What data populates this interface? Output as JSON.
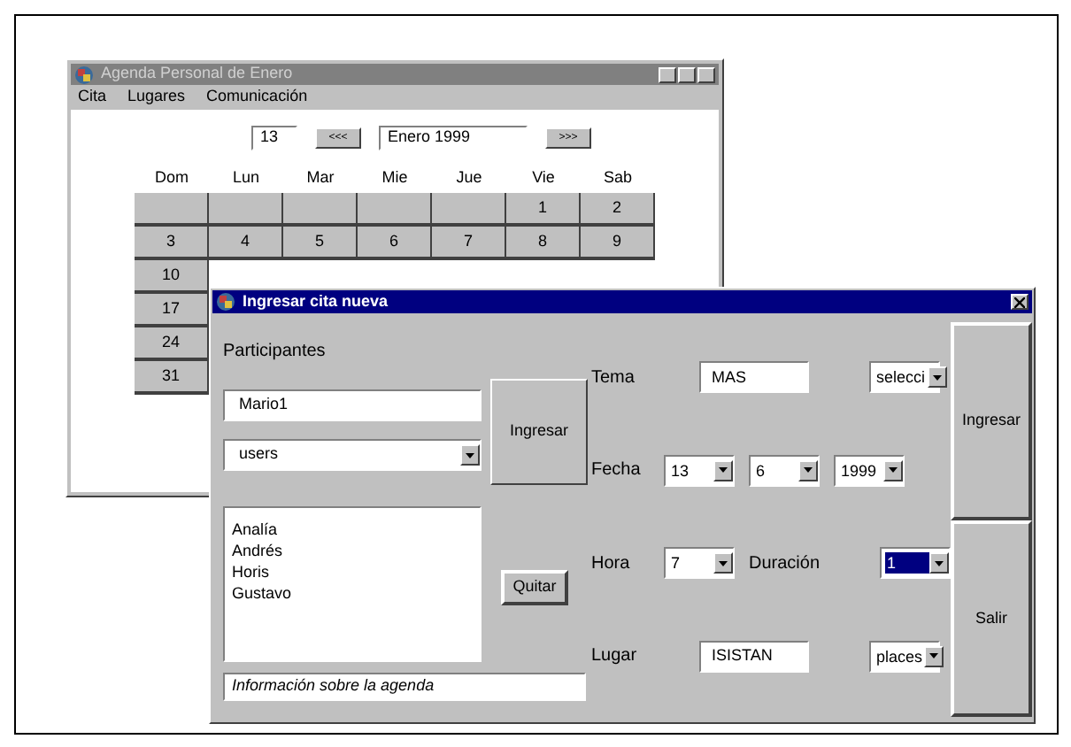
{
  "calendar_window": {
    "title": "Agenda Personal de Enero",
    "menu": [
      "Cita",
      "Lugares",
      "Comunicación"
    ],
    "day": "13",
    "prev_button": "<<<",
    "month": "Enero 1999",
    "next_button": ">>>",
    "weekdays": [
      "Dom",
      "Lun",
      "Mar",
      "Mie",
      "Jue",
      "Vie",
      "Sab"
    ],
    "weeks": [
      {
        "kind": "padded",
        "days": [
          "1",
          "2"
        ]
      },
      {
        "kind": "plain",
        "days": [
          "3",
          "4",
          "5",
          "6",
          "7",
          "8",
          "9"
        ]
      },
      {
        "kind": "plain",
        "days": [
          "10"
        ]
      },
      {
        "kind": "plain",
        "days": [
          "17"
        ]
      },
      {
        "kind": "plain",
        "days": [
          "24"
        ]
      },
      {
        "kind": "plain",
        "days": [
          "31"
        ]
      }
    ]
  },
  "dialog": {
    "title": "Ingresar cita nueva",
    "participants_label": "Participantes",
    "participant_field": "Mario1",
    "group_combo": "users",
    "add_button": "Ingresar",
    "remove_button": "Quitar",
    "participants": [
      "Analía",
      "Andrés",
      "Horis",
      "Gustavo"
    ],
    "info_field": "Información sobre la agenda",
    "rows": [
      {
        "label": "Tema",
        "controls": [
          {
            "kind": "text",
            "value": "MAS"
          },
          {
            "kind": "combo",
            "value": "selecci",
            "selected": false
          }
        ]
      },
      {
        "label": "Fecha",
        "controls": [
          {
            "kind": "combo",
            "value": "13",
            "selected": false
          },
          {
            "kind": "combo",
            "value": "6",
            "selected": false
          },
          {
            "kind": "combo",
            "value": "1999",
            "selected": false
          }
        ]
      },
      {
        "label": "Hora",
        "controls": [
          {
            "kind": "combo",
            "value": "7",
            "selected": false
          },
          {
            "kind": "label",
            "value": "Duración"
          },
          {
            "kind": "combo",
            "value": "1",
            "selected": true
          }
        ]
      },
      {
        "label": "Lugar",
        "controls": [
          {
            "kind": "text",
            "value": "ISISTAN"
          },
          {
            "kind": "combo",
            "value": "places",
            "selected": false
          }
        ]
      }
    ],
    "side_buttons": [
      "Ingresar",
      "Salir"
    ]
  }
}
